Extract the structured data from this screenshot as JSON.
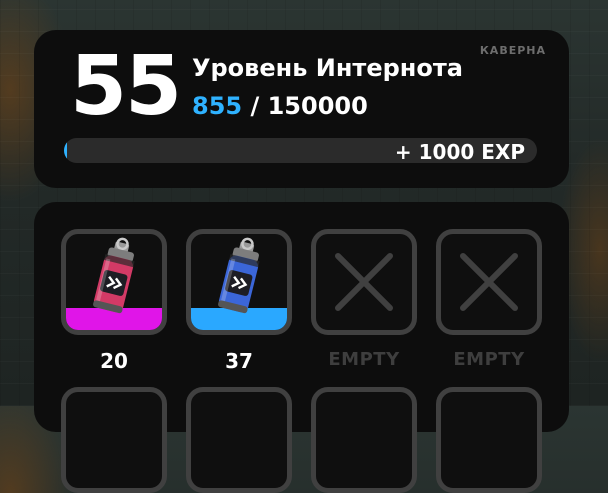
{
  "level": {
    "number": "55",
    "title": "Уровень Интернота",
    "tag": "КАВЕРНА",
    "exp_current": "855",
    "exp_separator": "/",
    "exp_required": "150000",
    "progress_fraction": 0.0057,
    "reward": "+ 1000 EXP",
    "accent_color": "#2fb2ff"
  },
  "slots": [
    {
      "label": "20",
      "empty": false,
      "item_icon": "grenade-icon",
      "color": "#e015e8",
      "item_color": "#d23a66"
    },
    {
      "label": "37",
      "empty": false,
      "item_icon": "grenade-icon",
      "color": "#2aa8ff",
      "item_color": "#3b66d8"
    },
    {
      "label": "EMPTY",
      "empty": true,
      "item_icon": "cross-icon"
    },
    {
      "label": "EMPTY",
      "empty": true,
      "item_icon": "cross-icon"
    },
    {
      "label": "",
      "empty": true,
      "item_icon": ""
    },
    {
      "label": "",
      "empty": true,
      "item_icon": ""
    },
    {
      "label": "",
      "empty": true,
      "item_icon": ""
    },
    {
      "label": "",
      "empty": true,
      "item_icon": ""
    }
  ]
}
